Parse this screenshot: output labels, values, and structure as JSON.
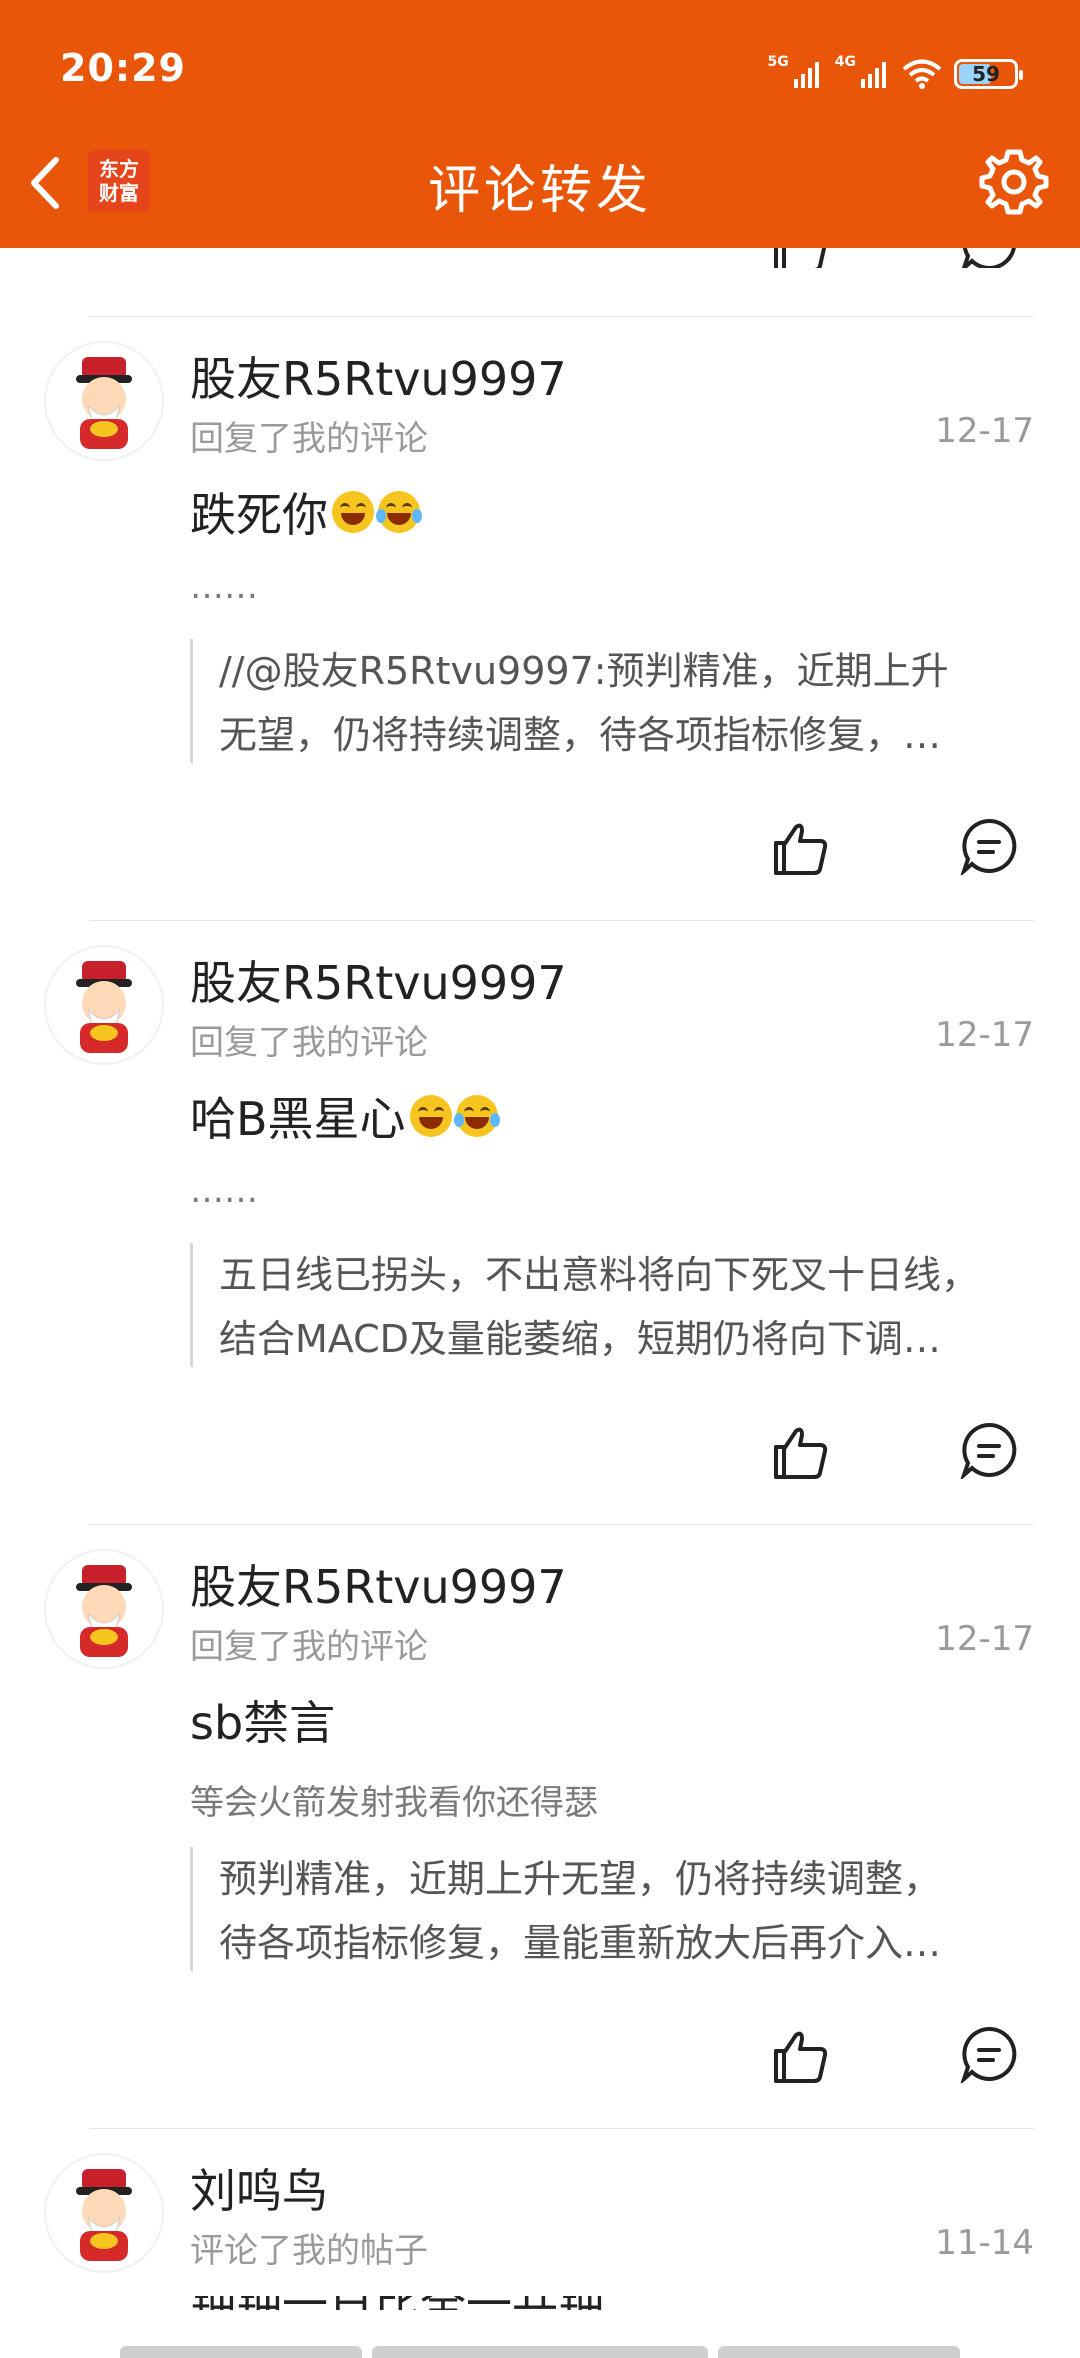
{
  "status_bar": {
    "time": "20:29",
    "network1": "5G",
    "network2": "4G",
    "battery": "59"
  },
  "header": {
    "logo_line1": "东方",
    "logo_line2": "财富",
    "title": "评论转发"
  },
  "items": [
    {
      "username": "股友R5Rtvu9997",
      "action": "回复了我的评论",
      "date": "12-17",
      "text": "跌死你",
      "reply": "……",
      "quote_line1": "//@股友R5Rtvu9997:预判精准，近期上升",
      "quote_line2": "无望，仍将持续调整，待各项指标修复，…"
    },
    {
      "username": "股友R5Rtvu9997",
      "action": "回复了我的评论",
      "date": "12-17",
      "text": "哈B黑星心",
      "reply": "……",
      "quote_line1": "五日线已拐头，不出意料将向下死叉十日线，",
      "quote_line2": "结合MACD及量能萎缩，短期仍将向下调…"
    },
    {
      "username": "股友R5Rtvu9997",
      "action": "回复了我的评论",
      "date": "12-17",
      "text": "sb禁言",
      "reply": "等会火箭发射我看你还得瑟",
      "quote_line1": "预判精准，近期上升无望，仍将持续调整，",
      "quote_line2": "待各项指标修复，量能重新放大后再介入…"
    },
    {
      "username": "刘鸣鸟",
      "action": "评论了我的帖子",
      "date": "11-14"
    }
  ],
  "peek_text": "钟钟一日比全一共钟",
  "colors": {
    "brand": "#E9560A",
    "secondary_text": "#9a9a9a"
  },
  "icons": [
    "back-arrow-icon",
    "settings-gear-icon",
    "thumb-up-icon",
    "comment-bubble-icon",
    "laugh-emoji-icon",
    "laugh-cry-emoji-icon"
  ]
}
